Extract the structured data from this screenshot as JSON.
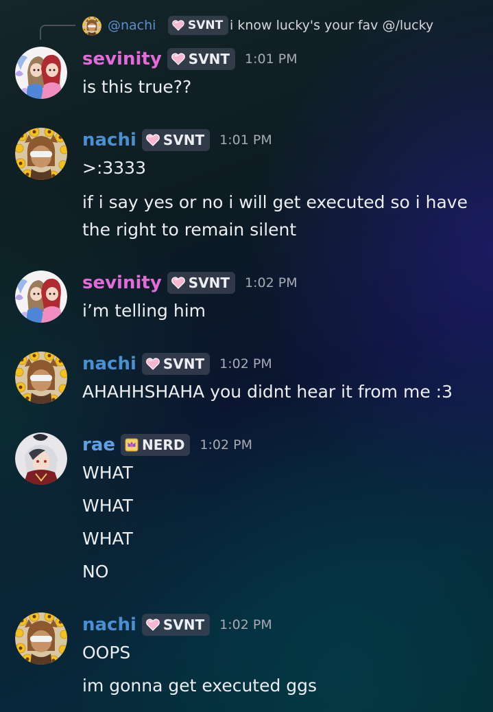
{
  "reply": {
    "author": "@nachi",
    "badge": "SVNT",
    "text": "i know lucky's your fav @/lucky"
  },
  "messages": [
    {
      "author": "sevinity",
      "badge": "SVNT",
      "badge_icon": "pink-heart-icon",
      "time": "1:01 PM",
      "lines": [
        "is this true??"
      ]
    },
    {
      "author": "nachi",
      "badge": "SVNT",
      "badge_icon": "pink-heart-icon",
      "time": "1:01 PM",
      "lines": [
        ">:3333",
        "if i say yes or no i will get executed so i have",
        "the right to remain silent"
      ]
    },
    {
      "author": "sevinity",
      "badge": "SVNT",
      "badge_icon": "pink-heart-icon",
      "time": "1:02 PM",
      "lines": [
        "i’m telling him"
      ]
    },
    {
      "author": "nachi",
      "badge": "SVNT",
      "badge_icon": "pink-heart-icon",
      "time": "1:02 PM",
      "lines": [
        "AHAHHSHAHA you didnt hear it from me :3"
      ]
    },
    {
      "author": "rae",
      "badge": "NERD",
      "badge_icon": "crown-badge-icon",
      "time": "1:02 PM",
      "lines": [
        "WHAT",
        "WHAT",
        "WHAT",
        "NO"
      ]
    },
    {
      "author": "nachi",
      "badge": "SVNT",
      "badge_icon": "pink-heart-icon",
      "time": "1:02 PM",
      "lines": [
        "OOPS",
        "im gonna get executed ggs"
      ]
    }
  ],
  "colors": {
    "sevinity": "#e36bd9",
    "nachi": "#4a8fd0",
    "rae": "#5ea1e3",
    "badge_heart": "#f4a6c8"
  }
}
